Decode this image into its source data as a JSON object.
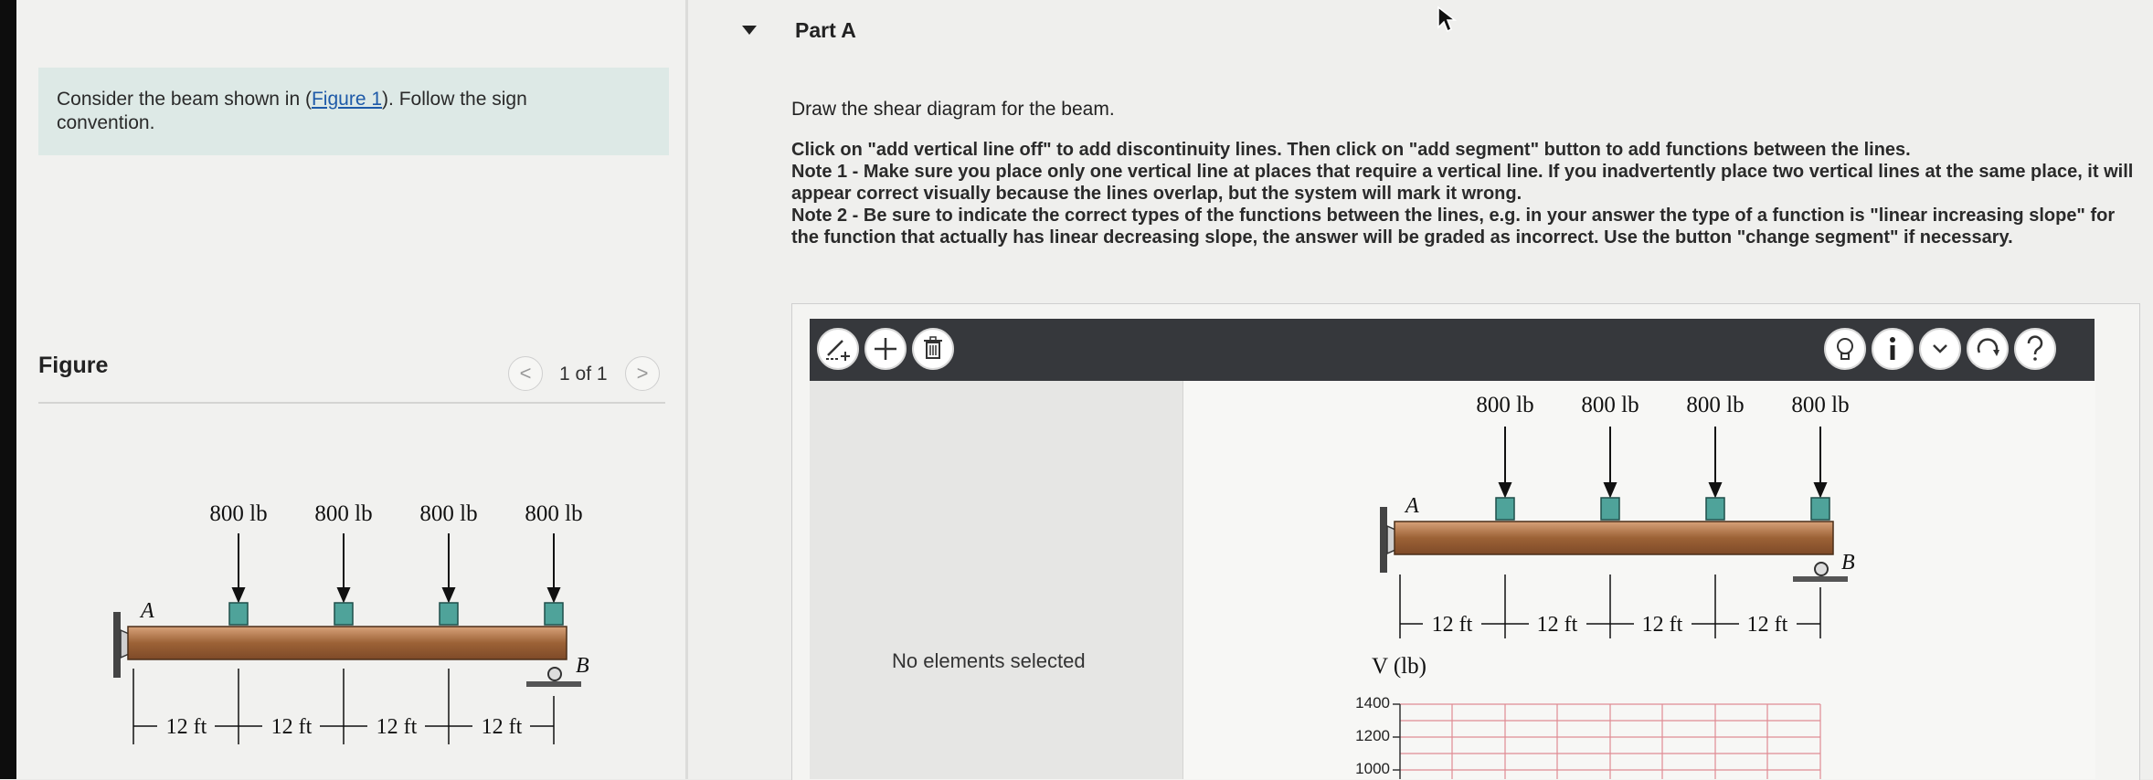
{
  "prompt": {
    "text_before": "Consider the beam shown in (",
    "figure_link": "Figure 1",
    "text_after": "). Follow the sign convention."
  },
  "figure": {
    "label": "Figure",
    "pager": {
      "prev": "<",
      "count": "1 of 1",
      "next": ">"
    },
    "support_a": "A",
    "support_b": "B",
    "loads": [
      "800 lb",
      "800 lb",
      "800 lb",
      "800 lb"
    ],
    "spans": [
      "12 ft",
      "12 ft",
      "12 ft",
      "12 ft"
    ]
  },
  "part": {
    "title": "Part A",
    "instruction": "Draw the shear diagram for the beam.",
    "notes": [
      "Click on \"add vertical line off\" to add discontinuity lines. Then click on \"add segment\" button to add functions between the lines.",
      "Note 1 - Make sure you place only one vertical line at places that require a vertical line. If you inadvertently place two vertical lines at the same place, it will appear correct visually because the lines overlap, but the system will mark it wrong.",
      "Note 2 - Be sure to indicate the correct types of the functions between the lines, e.g. in your answer the type of a function is \"linear increasing slope\" for the function that actually has linear decreasing slope, the answer will be graded as incorrect. Use the button \"change segment\" if necessary."
    ]
  },
  "tool": {
    "status": "No elements selected",
    "toolbar_icons": [
      "add-vertical-line-icon",
      "add-segment-icon",
      "delete-icon",
      "hint-icon",
      "info-icon",
      "chevron-down-icon",
      "reset-icon",
      "help-icon"
    ],
    "diagram": {
      "support_a": "A",
      "support_b": "B",
      "loads": [
        "800 lb",
        "800 lb",
        "800 lb",
        "800 lb"
      ],
      "spans": [
        "12 ft",
        "12 ft",
        "12 ft",
        "12 ft"
      ],
      "axis_label": "V (lb)",
      "y_ticks": [
        "1400",
        "1200",
        "1000"
      ]
    }
  },
  "colors": {
    "toolbar": "#36383c",
    "beam": "#b07446",
    "load_block": "#4fa39a",
    "grid": "#e08b93",
    "link": "#1e5aa8"
  }
}
